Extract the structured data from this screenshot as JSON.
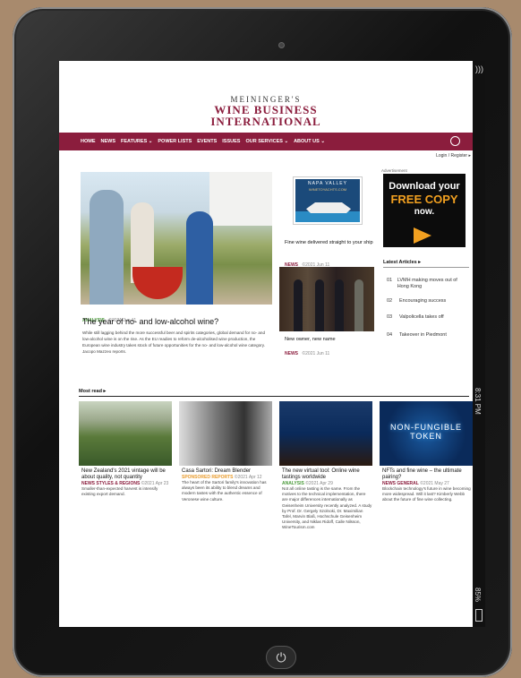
{
  "device": {
    "home_glyph": "⏻"
  },
  "status": {
    "time": "8:31 PM",
    "battery": "85%",
    "wifi_glyph": ")))"
  },
  "site": {
    "logo_top": "MEININGER'S",
    "logo_mid": "WINE BUSINESS",
    "logo_bot": "INTERNATIONAL"
  },
  "nav": {
    "items": [
      "HOME",
      "NEWS",
      "FEATURES ⌄",
      "POWER LISTS",
      "EVENTS",
      "ISSUES",
      "OUR SERVICES ⌄",
      "ABOUT US ⌄"
    ],
    "login": "Login / Register ▸"
  },
  "hero": {
    "tag": "ANALYSIS",
    "date": "©2021 Jun 11",
    "title": "The year of no- and low-alcohol wine?",
    "desc": "While still lagging behind the more successful beer and spirits categories, global demand for no- and low-alcohol wine is on the rise. As the EU readies to reform de-alcoholised wine production, the European wine industry takes stock of future opportunities for the no- and low-alcohol wine category. Jacopo Mazzeo reports."
  },
  "mid": {
    "ad_line1": "NAPA VALLEY",
    "ad_line2": "WINETOYACHTS.COM",
    "story1_title": "Fine wine delivered straight to your ship",
    "story1_tag": "NEWS",
    "story1_date": "©2021 Jun 11",
    "story2_title": "New owner, new name",
    "story2_tag": "NEWS",
    "story2_date": "©2021 Jun 11"
  },
  "ad": {
    "label": "Advertisement",
    "line1": "Download your",
    "line2": "FREE COPY",
    "line3": "now."
  },
  "latest": {
    "heading": "Latest Articles ▸",
    "items": [
      {
        "n": "01",
        "t": "LVMH making moves out of Hong Kong"
      },
      {
        "n": "02",
        "t": "Encouraging success"
      },
      {
        "n": "03",
        "t": "Valpolicella takes off"
      },
      {
        "n": "04",
        "t": "Takeover in Piedmont"
      }
    ]
  },
  "most_read": {
    "heading": "Most read ▸",
    "cards": [
      {
        "title": "New Zealand's 2021 vintage will be about quality, not quantity",
        "cat": "NEWS STYLES & REGIONS",
        "date": "©2021 Apr 23",
        "desc": "Smaller-than-expected harvest is intensify existing export demand."
      },
      {
        "title": "Casa Sartori: Dream Blender",
        "cat": "SPONSORED REPORTS",
        "date": "©2021 Apr 12",
        "desc": "The heart of the Sartori family's innovation has always been its ability to blend dreams and modern tastes with the authentic essence of Veronese wine culture."
      },
      {
        "title": "The new virtual tool: Online wine tastings worldwide",
        "cat": "ANALYSIS",
        "date": "©2021 Apr 29",
        "desc": "Not all online tasting is the same. From the motives to the technical implementation, there are major differences internationally as Geisenheim University recently analyzed. A study by Prof. Dr. Gergely Szolnoki, Dr. Maximilian Tafel, Marvin Blaß, Hochschule Geisenheim University, and Niklas Ridoff, Calle Nilsson, WineTourism.com"
      },
      {
        "title": "NFTs and fine wine – the ultimate pairing?",
        "cat": "NEWS GENERAL",
        "date": "©2021 May 27",
        "desc": "Blockchain technology's future in wine becoming more widespread. Will it last? Kimberly Webb about the future of fine wine collecting.",
        "img_text": "NON-FUNGIBLE TOKEN"
      }
    ]
  }
}
